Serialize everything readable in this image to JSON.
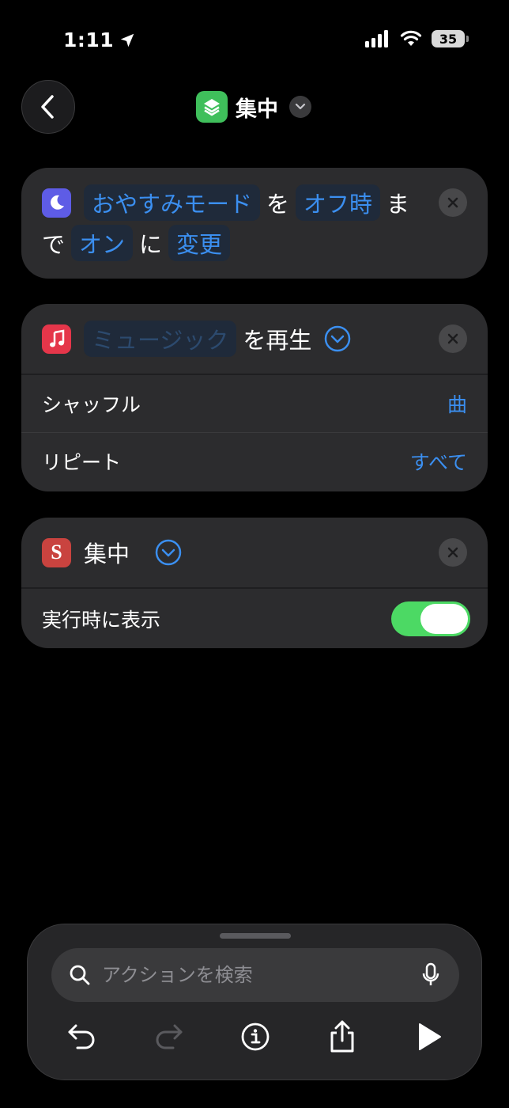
{
  "status_bar": {
    "time": "1:11",
    "battery": "35"
  },
  "header": {
    "title": "集中",
    "back_icon": "chevron-left-icon",
    "app_icon": "layers-icon"
  },
  "focus_action": {
    "icon": "moon-icon",
    "mode": "おやすみモード",
    "particle_1": "を",
    "until": "オフ時",
    "particle_2a": "ま",
    "particle_2b": "で",
    "state": "オン",
    "particle_3": "に",
    "verb": "変更"
  },
  "music_action": {
    "icon": "music-note-icon",
    "placeholder": "ミュージック",
    "suffix": "を再生",
    "rows": [
      {
        "label": "シャッフル",
        "value": "曲"
      },
      {
        "label": "リピート",
        "value": "すべて"
      }
    ]
  },
  "shortcut_action": {
    "icon": "shortcuts-s-icon",
    "title": "集中",
    "show_when_run_label": "実行時に表示",
    "show_when_run": true
  },
  "bottom_panel": {
    "search_placeholder": "アクションを検索"
  },
  "colors": {
    "accent": "#3b8ff0",
    "toggle_on": "#4cd964",
    "card_bg": "#2c2c2e"
  }
}
